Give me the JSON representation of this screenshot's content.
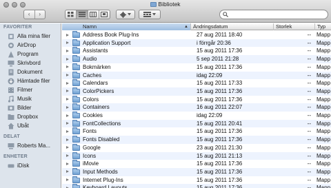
{
  "window": {
    "title": "Bibliotek",
    "back_label": "‹",
    "forward_label": "›"
  },
  "toolbar": {
    "views": [
      "icon-view",
      "list-view",
      "column-view",
      "coverflow-view"
    ],
    "active_view": 1,
    "search_value": ""
  },
  "sidebar": {
    "sections": [
      {
        "header": "FAVORITER",
        "items": [
          {
            "label": "Alla mina filer",
            "icon": "all-files-icon"
          },
          {
            "label": "AirDrop",
            "icon": "airdrop-icon"
          },
          {
            "label": "Program",
            "icon": "applications-icon"
          },
          {
            "label": "Skrivbord",
            "icon": "desktop-icon"
          },
          {
            "label": "Dokument",
            "icon": "documents-icon"
          },
          {
            "label": "Hämtade filer",
            "icon": "downloads-icon"
          },
          {
            "label": "Filmer",
            "icon": "movies-icon"
          },
          {
            "label": "Musik",
            "icon": "music-icon"
          },
          {
            "label": "Bilder",
            "icon": "pictures-icon"
          },
          {
            "label": "Dropbox",
            "icon": "dropbox-icon"
          },
          {
            "label": "Ubåt",
            "icon": "home-folder-icon"
          }
        ]
      },
      {
        "header": "DELAT",
        "items": [
          {
            "label": "Roberts Ma...",
            "icon": "computer-icon"
          }
        ]
      },
      {
        "header": "ENHETER",
        "items": [
          {
            "label": "iDisk",
            "icon": "idisk-icon"
          }
        ]
      }
    ]
  },
  "columns": {
    "name": "Namn",
    "date": "Ändringsdatum",
    "size": "Storlek",
    "kind": "Typ"
  },
  "files": [
    {
      "name": "Address Book Plug-Ins",
      "date": "27 aug 2011 18:40",
      "size": "--",
      "kind": "Mapp"
    },
    {
      "name": "Application Support",
      "date": "i förrgår 20:36",
      "size": "--",
      "kind": "Mapp"
    },
    {
      "name": "Assistants",
      "date": "15 aug 2011 17:36",
      "size": "--",
      "kind": "Mapp"
    },
    {
      "name": "Audio",
      "date": "5 sep 2011 21:28",
      "size": "--",
      "kind": "Mapp"
    },
    {
      "name": "Bokmärken",
      "date": "15 aug 2011 17:36",
      "size": "--",
      "kind": "Mapp"
    },
    {
      "name": "Caches",
      "date": "idag 22:09",
      "size": "--",
      "kind": "Mapp"
    },
    {
      "name": "Calendars",
      "date": "15 aug 2011 17:33",
      "size": "--",
      "kind": "Mapp"
    },
    {
      "name": "ColorPickers",
      "date": "15 aug 2011 17:36",
      "size": "--",
      "kind": "Mapp"
    },
    {
      "name": "Colors",
      "date": "15 aug 2011 17:36",
      "size": "--",
      "kind": "Mapp"
    },
    {
      "name": "Containers",
      "date": "16 aug 2011 22:07",
      "size": "--",
      "kind": "Mapp"
    },
    {
      "name": "Cookies",
      "date": "idag 22:09",
      "size": "--",
      "kind": "Mapp"
    },
    {
      "name": "FontCollections",
      "date": "15 aug 2011 20:41",
      "size": "--",
      "kind": "Mapp"
    },
    {
      "name": "Fonts",
      "date": "15 aug 2011 17:36",
      "size": "--",
      "kind": "Mapp"
    },
    {
      "name": "Fonts Disabled",
      "date": "15 aug 2011 17:36",
      "size": "--",
      "kind": "Mapp"
    },
    {
      "name": "Google",
      "date": "23 aug 2011 21:30",
      "size": "--",
      "kind": "Mapp"
    },
    {
      "name": "Icons",
      "date": "15 aug 2011 21:13",
      "size": "--",
      "kind": "Mapp"
    },
    {
      "name": "iMovie",
      "date": "15 aug 2011 17:36",
      "size": "--",
      "kind": "Mapp"
    },
    {
      "name": "Input Methods",
      "date": "15 aug 2011 17:36",
      "size": "--",
      "kind": "Mapp"
    },
    {
      "name": "Internet Plug-Ins",
      "date": "15 aug 2011 17:36",
      "size": "--",
      "kind": "Mapp"
    },
    {
      "name": "Keyboard Layouts",
      "date": "15 aug 2011 17:36",
      "size": "--",
      "kind": "Mapp"
    }
  ]
}
